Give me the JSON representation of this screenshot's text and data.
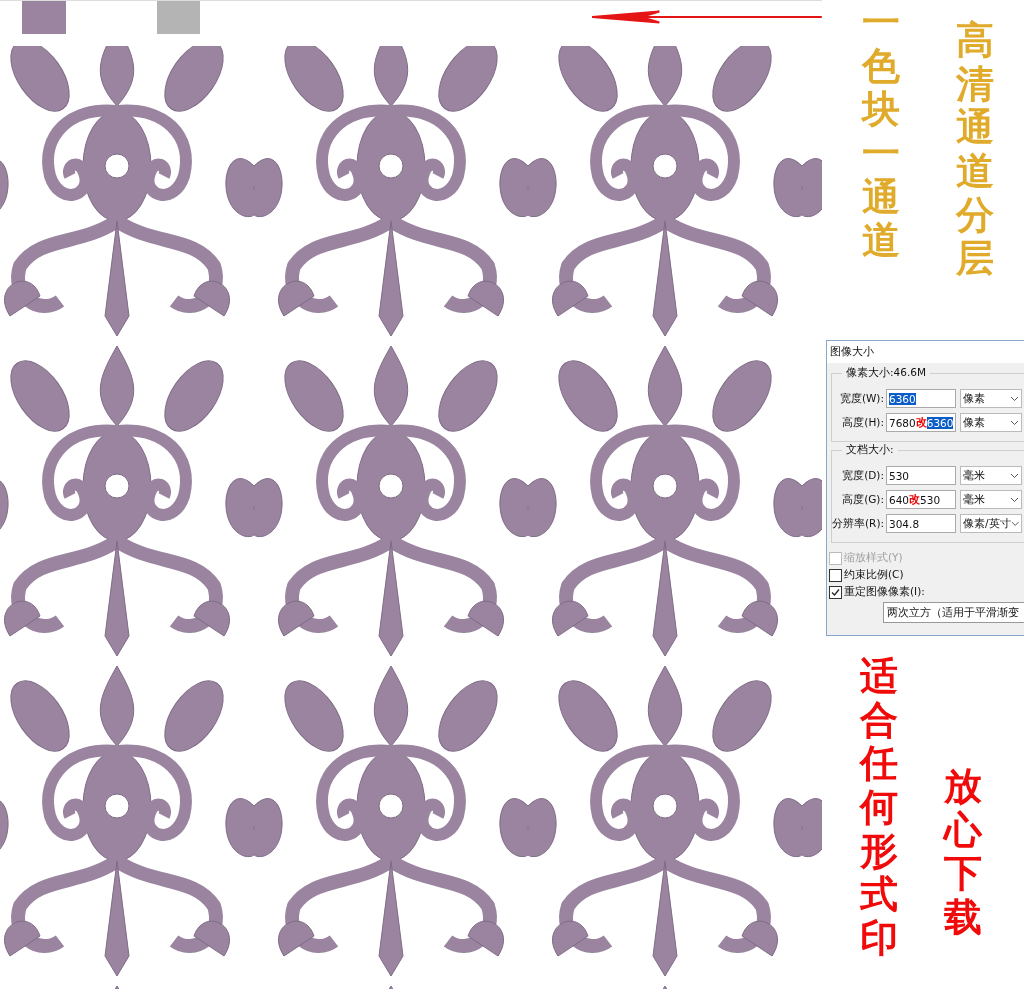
{
  "swatches": [
    {
      "color": "#9a84a0"
    },
    {
      "color": "#b4b4b4"
    }
  ],
  "captions_top": [
    "一色块一通道",
    "高清通道分层"
  ],
  "dialog": {
    "title": "图像大小",
    "pixel_group": {
      "legend": "像素大小:46.6M",
      "rows": [
        {
          "label": "宽度(W):",
          "value": "6360",
          "highlighted": true,
          "unit": "像素"
        },
        {
          "label": "高度(H):",
          "old_value": "7680",
          "mark": "改",
          "value": "6360",
          "highlighted": true,
          "unit": "像素"
        }
      ]
    },
    "document_group": {
      "legend": "文档大小:",
      "rows": [
        {
          "label": "宽度(D):",
          "value": "530",
          "highlighted": false,
          "unit": "毫米"
        },
        {
          "label": "高度(G):",
          "old_value": "640",
          "mark": "改",
          "value": "530",
          "highlighted": false,
          "unit": "毫米"
        },
        {
          "label": "分辨率(R):",
          "value": "304.8",
          "highlighted": false,
          "unit": "像素/英寸"
        }
      ]
    },
    "options": [
      {
        "label": "缩放样式(Y)",
        "checked": false,
        "disabled": true
      },
      {
        "label": "约束比例(C)",
        "checked": false,
        "disabled": false
      },
      {
        "label": "重定图像像素(I):",
        "checked": true,
        "disabled": false
      }
    ],
    "resample": "两次立方（适用于平滑渐变"
  },
  "captions_bottom": [
    "适合任何形式印",
    "放心下载"
  ]
}
